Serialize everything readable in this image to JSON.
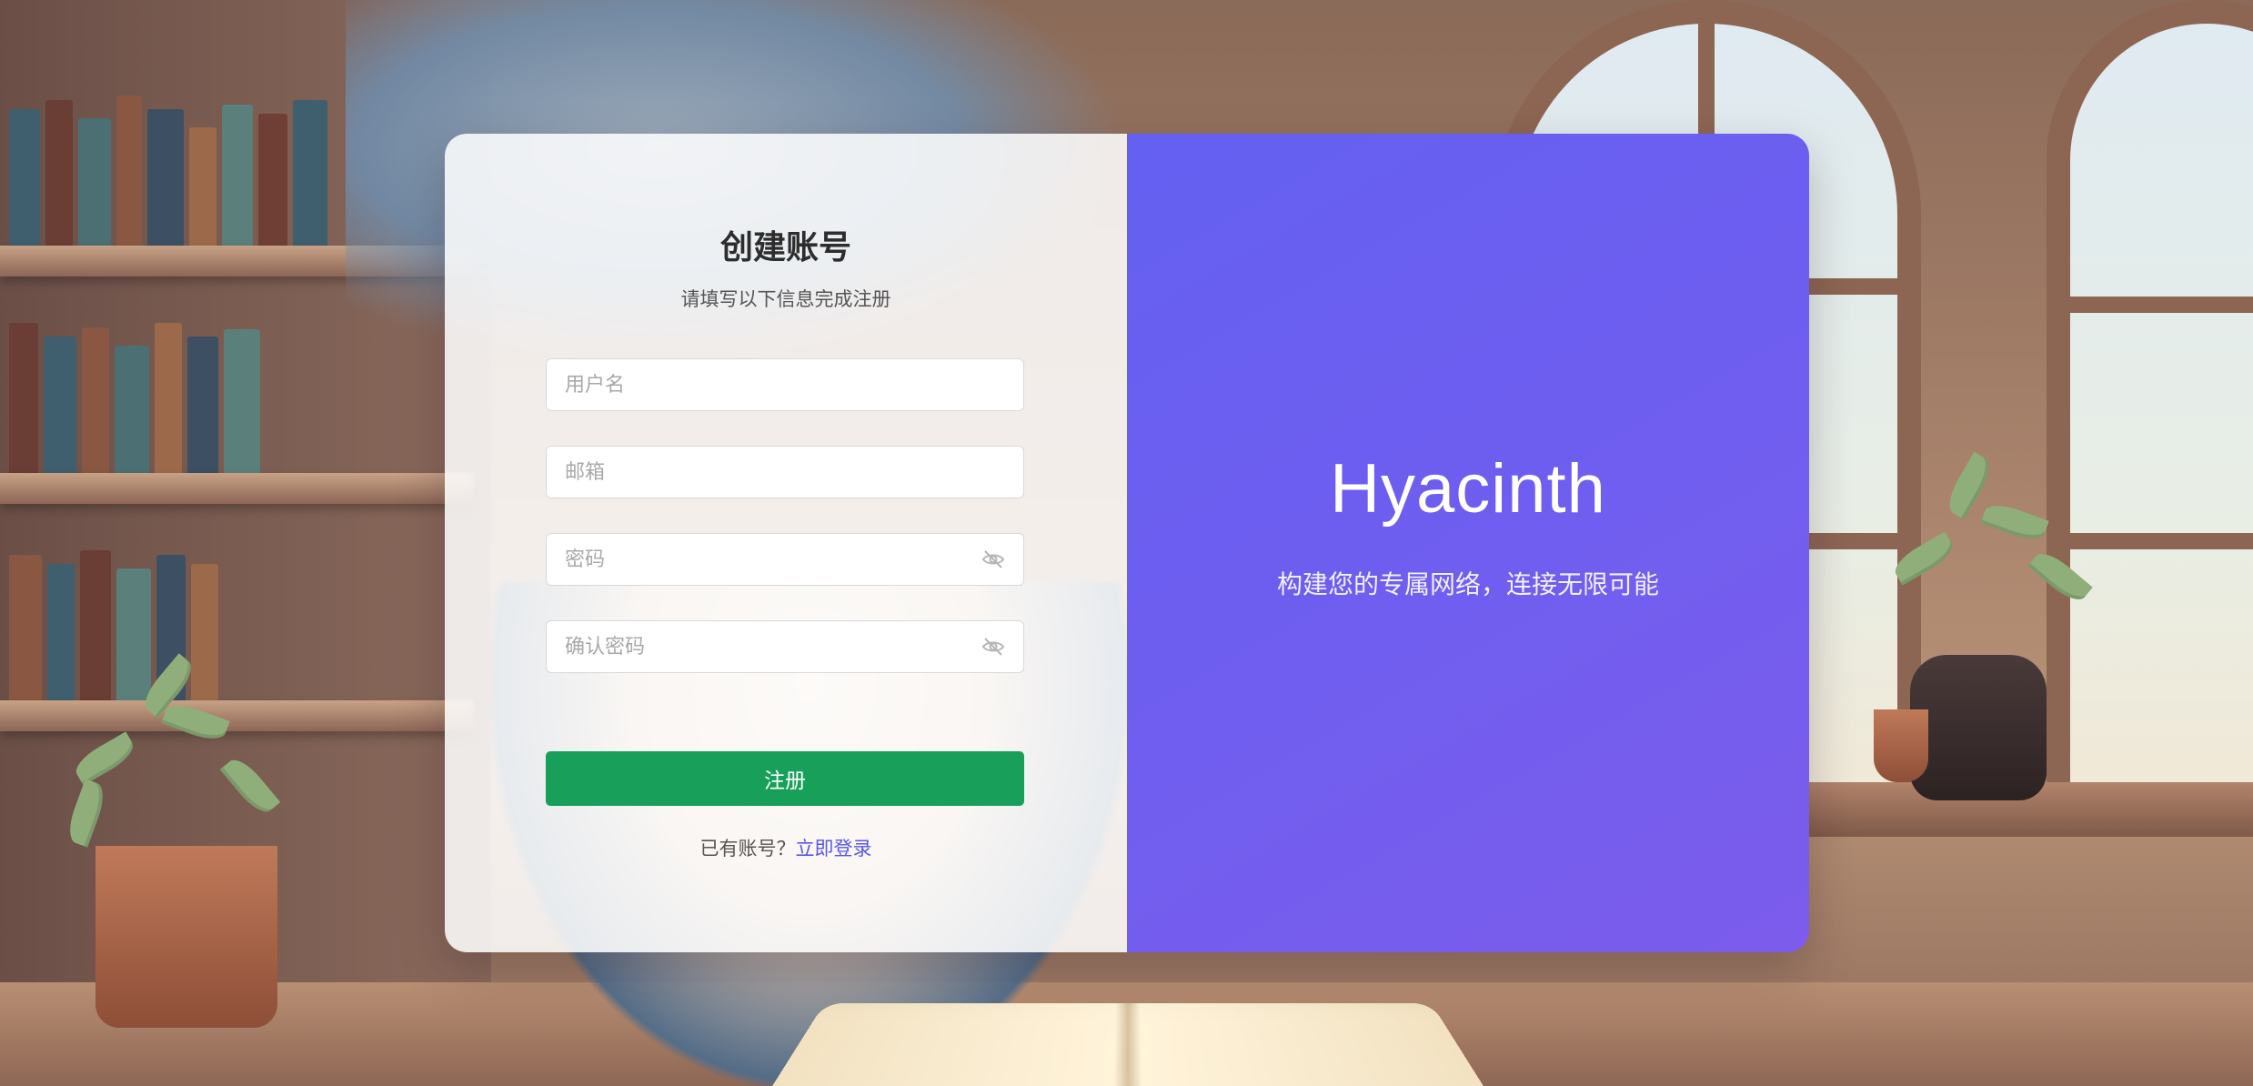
{
  "background": {
    "description_icon": "anime-library-illustration-icon"
  },
  "form": {
    "title": "创建账号",
    "subtitle": "请填写以下信息完成注册",
    "username_placeholder": "用户名",
    "email_placeholder": "邮箱",
    "password_placeholder": "密码",
    "confirm_password_placeholder": "确认密码",
    "password_visibility_icon": "eye-off-icon",
    "submit_label": "注册",
    "login_prompt": "已有账号？",
    "login_link": "立即登录"
  },
  "brand": {
    "name": "Hyacinth",
    "tagline": "构建您的专属网络，连接无限可能"
  },
  "colors": {
    "accent": "#6c5ef0",
    "submit": "#18a05a",
    "link": "#5b56e6"
  }
}
